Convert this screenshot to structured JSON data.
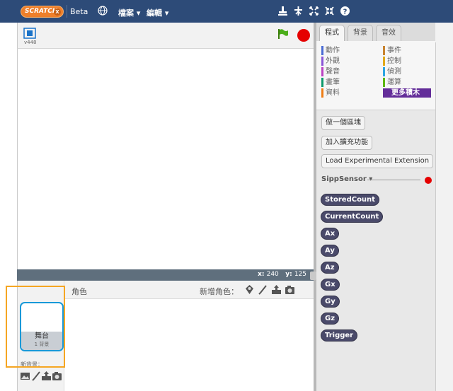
{
  "topbar": {
    "logo_text": "SCRATCH",
    "beta_label": "Beta",
    "menus": [
      "檔案 ▾",
      "編輯 ▾"
    ],
    "tools": [
      "stamp-icon",
      "cut-icon",
      "grow-icon",
      "shrink-icon",
      "help-icon"
    ],
    "colors": {
      "bar": "#2d4b78",
      "logo": "#ee7f2a"
    }
  },
  "stage": {
    "version": "v448",
    "x_label": "x:",
    "x_value": "240",
    "y_label": "y:",
    "y_value": "125"
  },
  "sprites": {
    "title": "角色",
    "new_sprite_label": "新增角色：",
    "stage_thumb_name": "舞台",
    "stage_thumb_sub": "1 背景",
    "new_backdrop_label": "新背景："
  },
  "palette": {
    "tabs": [
      "程式",
      "背景",
      "音效"
    ],
    "categories_left": [
      {
        "label": "動作",
        "color": "#4a6cd4"
      },
      {
        "label": "外觀",
        "color": "#8a55d7"
      },
      {
        "label": "聲音",
        "color": "#bb42c3"
      },
      {
        "label": "畫筆",
        "color": "#0e9a6c"
      },
      {
        "label": "資料",
        "color": "#ee7d16"
      }
    ],
    "categories_right": [
      {
        "label": "事件",
        "color": "#c88330"
      },
      {
        "label": "控制",
        "color": "#e1a91a"
      },
      {
        "label": "偵測",
        "color": "#2ca5e2"
      },
      {
        "label": "運算",
        "color": "#5cb712"
      },
      {
        "label": "更多積木",
        "color": "#632d99"
      }
    ],
    "make_block": "做一個區塊",
    "add_extension": "加入擴充功能",
    "load_experimental": "Load Experimental Extension",
    "extension_name": "SippSensor ▾",
    "blocks": [
      "StoredCount",
      "CurrentCount",
      "Ax",
      "Ay",
      "Az",
      "Gx",
      "Gy",
      "Gz",
      "Trigger"
    ]
  }
}
